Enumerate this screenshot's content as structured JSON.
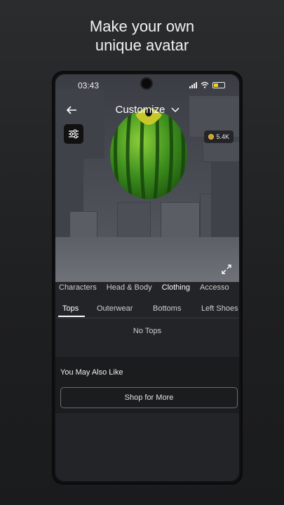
{
  "headline": {
    "line1": "Make your own",
    "line2": "unique avatar"
  },
  "status_bar": {
    "time": "03:43",
    "battery_color": "#f5d020"
  },
  "topbar": {
    "title": "Customize"
  },
  "currency": {
    "amount": "5.4K",
    "icon": "robux-coin-icon"
  },
  "categories": [
    "Characters",
    "Head & Body",
    "Clothing",
    "Accesso"
  ],
  "active_category": "Clothing",
  "subtabs": [
    "Tops",
    "Outerwear",
    "Bottoms",
    "Left Shoes"
  ],
  "active_subtab": "Tops",
  "empty_state": "No Tops",
  "recommendations": {
    "title": "You May Also Like",
    "button": "Shop for More"
  }
}
